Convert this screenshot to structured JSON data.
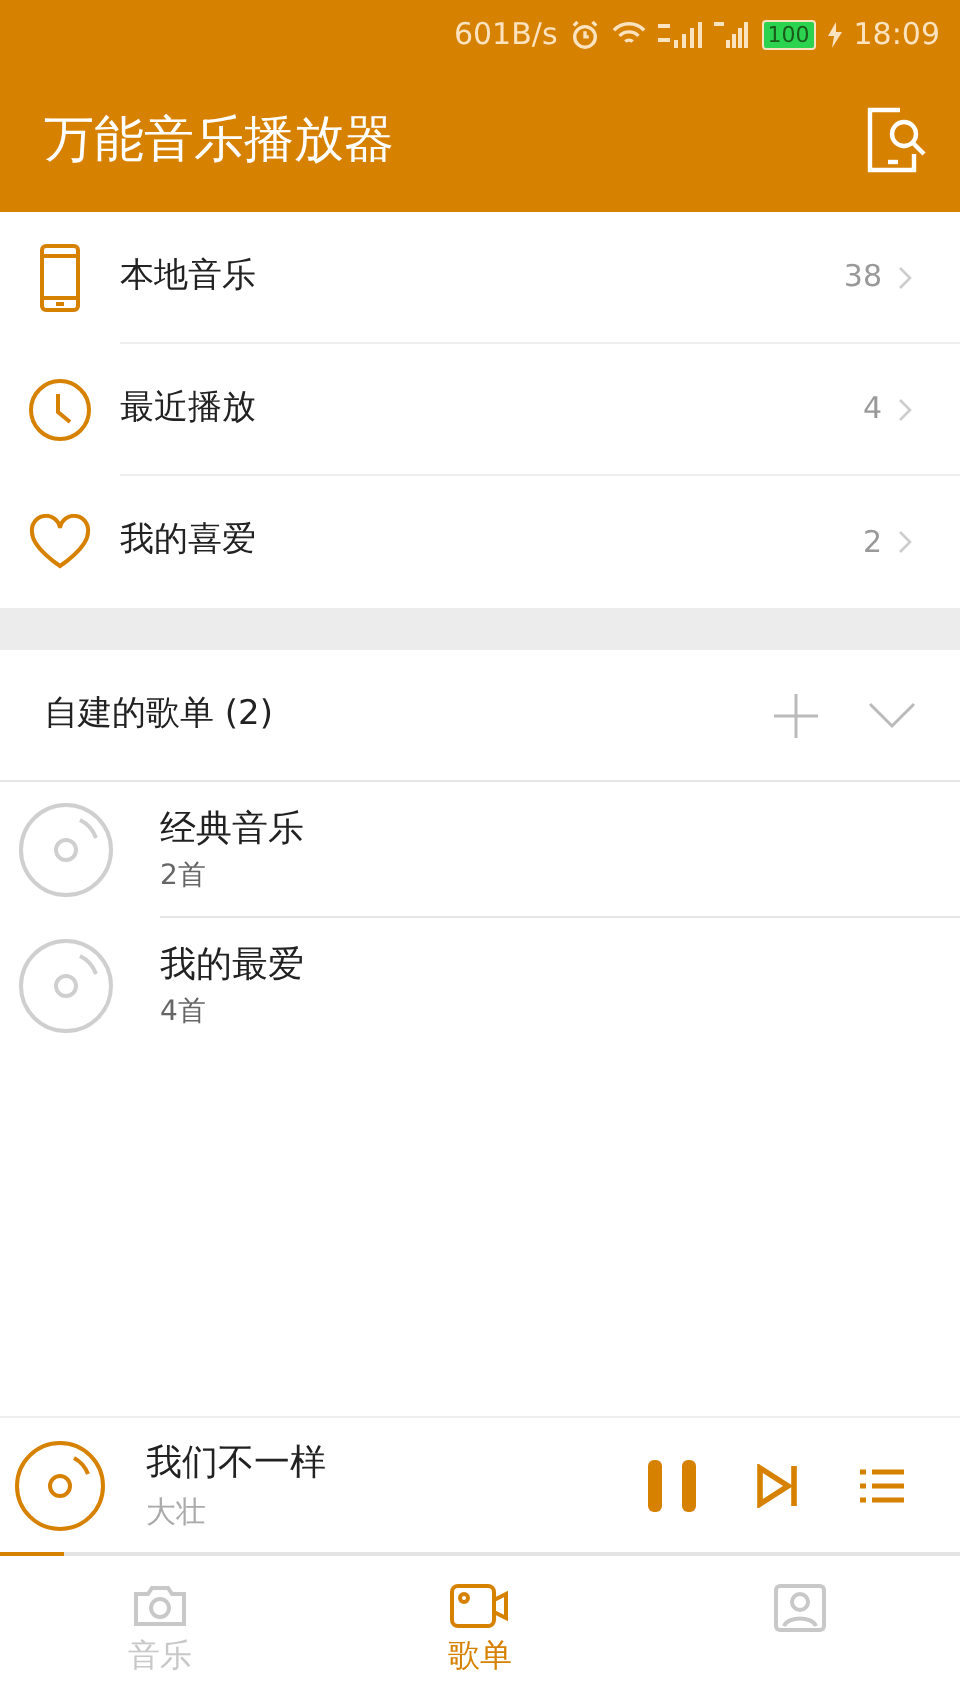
{
  "status_bar": {
    "speed": "601B/s",
    "battery": "100",
    "time": "18:09"
  },
  "header": {
    "title": "万能音乐播放器"
  },
  "local_items": [
    {
      "kind": "phone",
      "label": "本地音乐",
      "count": "38"
    },
    {
      "kind": "clock",
      "label": "最近播放",
      "count": "4"
    },
    {
      "kind": "heart",
      "label": "我的喜爱",
      "count": "2"
    }
  ],
  "playlists_header": {
    "title": "自建的歌单 (2)"
  },
  "playlists": [
    {
      "name": "经典音乐",
      "count": "2首"
    },
    {
      "name": "我的最爱",
      "count": "4首"
    }
  ],
  "now_playing": {
    "title": "我们不一样",
    "artist": "大壮",
    "level": 0.067,
    "playing": true
  },
  "tabs": [
    {
      "kind": "camera",
      "label": "音乐",
      "selected": false
    },
    {
      "kind": "video",
      "label": "歌单",
      "selected": true
    },
    {
      "kind": "person",
      "selected": false
    }
  ]
}
